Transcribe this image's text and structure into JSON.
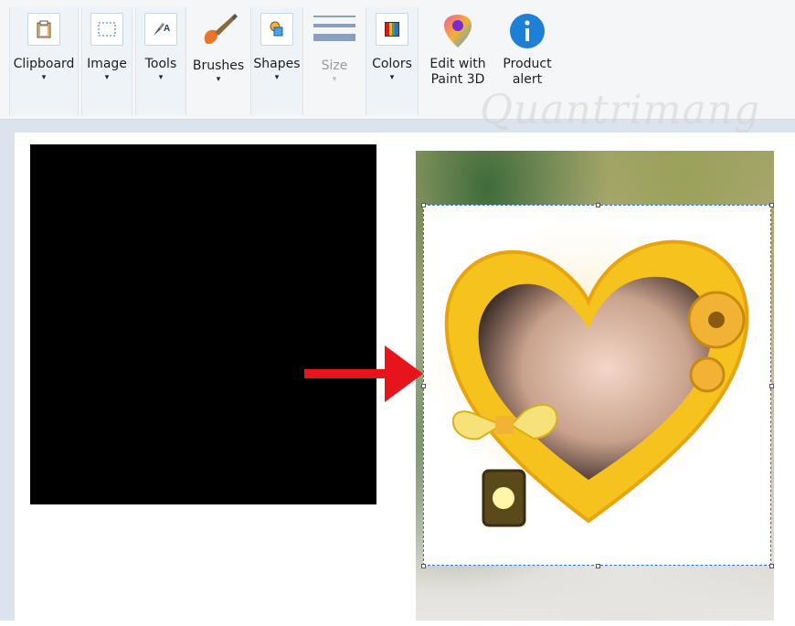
{
  "ribbon": {
    "groups": [
      {
        "id": "clipboard",
        "label": "Clipboard",
        "icon": "clipboard-icon",
        "has_caret": true,
        "enabled": true
      },
      {
        "id": "image",
        "label": "Image",
        "icon": "select-icon",
        "has_caret": true,
        "enabled": true
      },
      {
        "id": "tools",
        "label": "Tools",
        "icon": "tools-icon",
        "has_caret": true,
        "enabled": true
      },
      {
        "id": "brushes",
        "label": "Brushes",
        "icon": "brush-icon",
        "has_caret": true,
        "enabled": true
      },
      {
        "id": "shapes",
        "label": "Shapes",
        "icon": "shapes-icon",
        "has_caret": true,
        "enabled": true
      },
      {
        "id": "size",
        "label": "Size",
        "icon": "size-lines-icon",
        "has_caret": true,
        "enabled": false
      },
      {
        "id": "colors",
        "label": "Colors",
        "icon": "color-palette-icon",
        "has_caret": true,
        "enabled": true
      },
      {
        "id": "paint3d",
        "label_line1": "Edit with",
        "label_line2": "Paint 3D",
        "icon": "paint3d-icon",
        "has_caret": false,
        "enabled": true
      },
      {
        "id": "product_alert",
        "label_line1": "Product",
        "label_line2": "alert",
        "icon": "info-icon",
        "has_caret": false,
        "enabled": true
      }
    ],
    "caret_glyph": "▾"
  },
  "watermark": "Quantrimang",
  "colors": {
    "ribbon_bg": "#f5f6f7",
    "group_bg": "#eef3f8",
    "canvas_bg": "#dbe3ee",
    "selection_border": "#2f6fd0",
    "arrow": "#e8141b",
    "info_blue": "#1e7fd6"
  }
}
